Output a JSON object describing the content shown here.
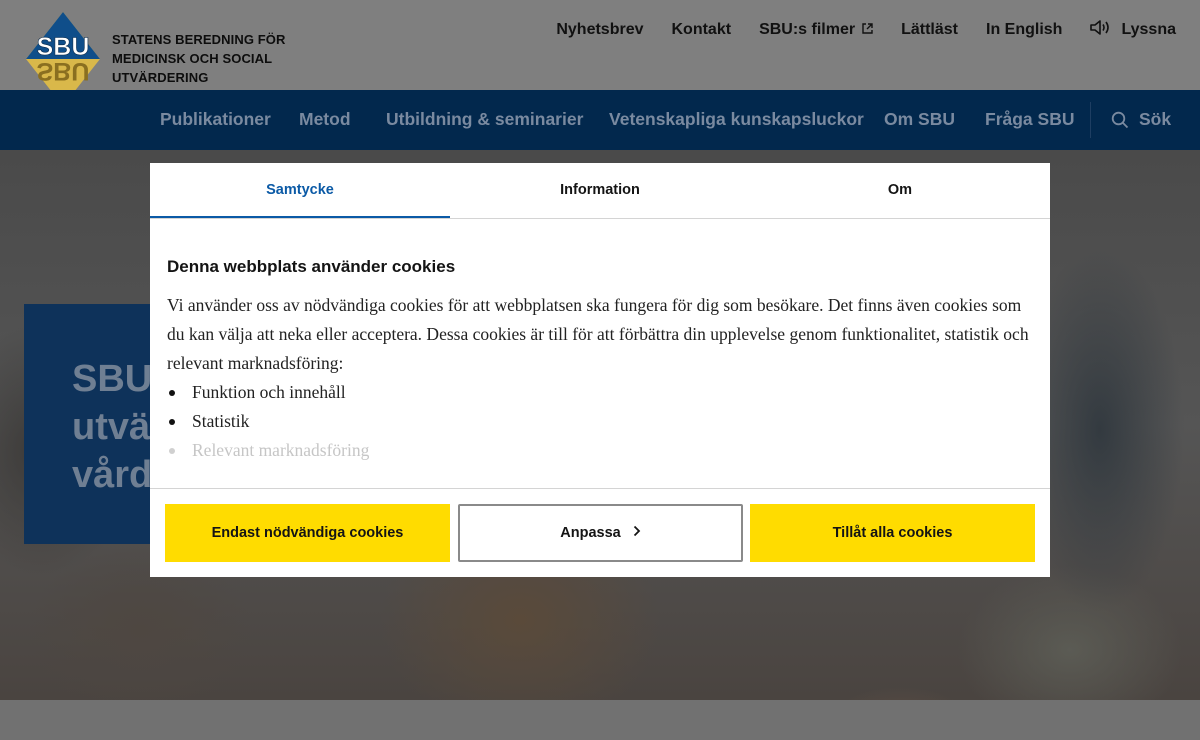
{
  "header": {
    "org_name_lines": [
      "STATENS BEREDNING FÖR",
      "MEDICINSK OCH SOCIAL",
      "UTVÄRDERING"
    ],
    "logo_text_top": "SBU",
    "logo_text_bottom": "SBU",
    "top_links": [
      "Nyhetsbrev",
      "Kontakt",
      "SBU:s filmer",
      "Lättläst",
      "In English",
      "Lyssna"
    ]
  },
  "nav": {
    "items": [
      "Publikationer",
      "Metod",
      "Utbildning & seminarier",
      "Vetenskapliga kunskapsluckor",
      "Om SBU",
      "Fråga SBU"
    ],
    "search_label": "Sök"
  },
  "hero": {
    "lines": [
      "SBU",
      "utvä",
      "vård"
    ]
  },
  "cookie_modal": {
    "tabs": [
      "Samtycke",
      "Information",
      "Om"
    ],
    "active_tab": "Samtycke",
    "title": "Denna webbplats använder cookies",
    "body": "Vi använder oss av nödvändiga cookies för att webbplatsen ska fungera för dig som besökare. Det finns även cookies som du kan välja att neka eller acceptera. Dessa cookies är till för att förbättra din upplevelse genom funktionalitet, statistik och relevant marknadsföring:",
    "list": [
      "Funktion och innehåll",
      "Statistik",
      "Relevant marknadsföring"
    ],
    "buttons": {
      "necessary": "Endast nödvändiga cookies",
      "customize": "Anpassa",
      "allow_all": "Tillåt alla cookies"
    }
  },
  "colors": {
    "nav_bg": "#02284d",
    "accent_blue": "#0b5aa6",
    "button_yellow": "#ffdc00"
  },
  "icons": {
    "external": "external-link-icon",
    "speaker": "speaker-icon",
    "search": "search-icon",
    "chevron": "chevron-right-icon"
  }
}
